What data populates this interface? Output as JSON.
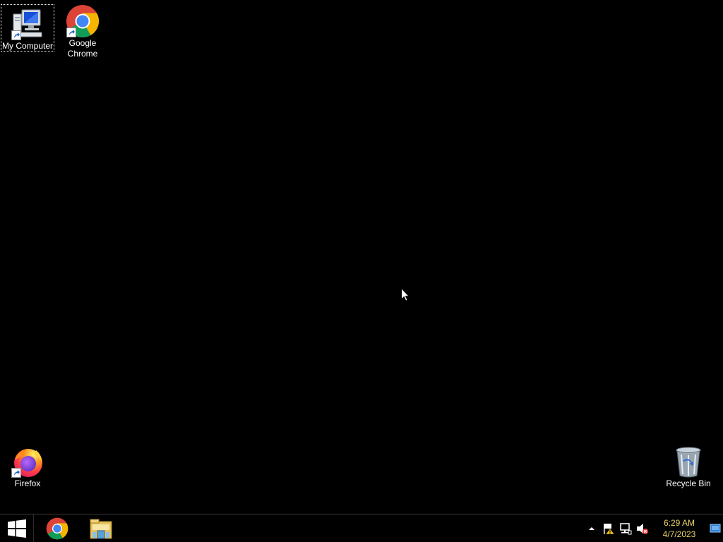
{
  "desktop": {
    "icons": [
      {
        "id": "my-computer",
        "label": "My Computer",
        "selected": true
      },
      {
        "id": "google-chrome",
        "label": "Google Chrome"
      },
      {
        "id": "firefox",
        "label": "Firefox"
      },
      {
        "id": "recycle-bin",
        "label": "Recycle Bin"
      }
    ]
  },
  "taskbar": {
    "pinned": [
      {
        "name": "Google Chrome",
        "icon": "chrome-icon"
      },
      {
        "name": "File Explorer",
        "icon": "folder-icon"
      }
    ],
    "tray": {
      "icons": [
        "show-hidden-icons",
        "action-center-warning-icon",
        "network-icon",
        "volume-muted-icon"
      ]
    },
    "clock": {
      "time": "6:29 AM",
      "date": "4/7/2023"
    }
  },
  "colors": {
    "desktop_background": "#000000",
    "clock_text": "#e8d36a"
  }
}
